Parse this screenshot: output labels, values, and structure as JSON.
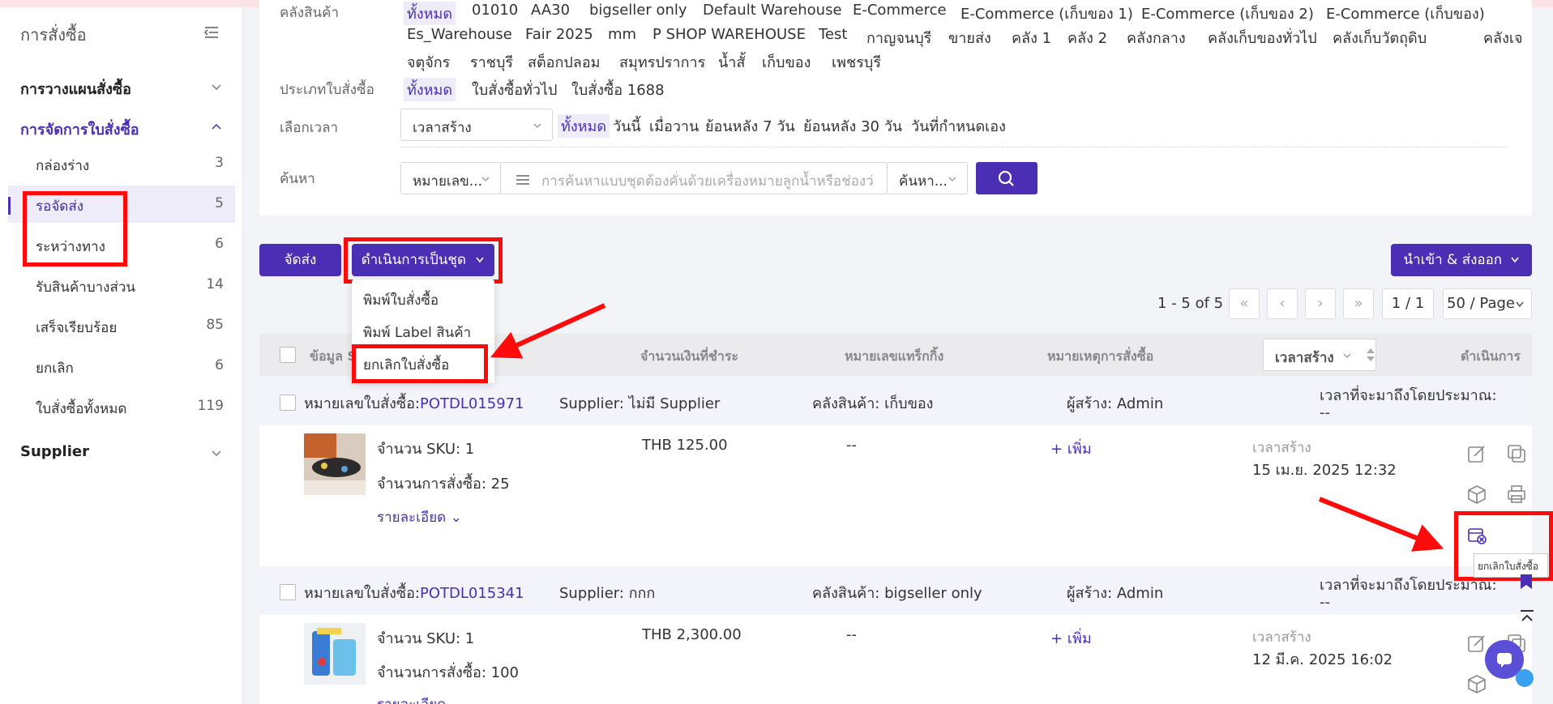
{
  "sidebar": {
    "title": "การสั่งซื้อ",
    "groups": [
      {
        "label": "การวางแผนสั่งซื้อ"
      },
      {
        "label": "การจัดการใบสั่งซื้อ"
      },
      {
        "label": "Supplier"
      }
    ],
    "items": [
      {
        "label": "กล่องร่าง",
        "count": "3"
      },
      {
        "label": "รอจัดส่ง",
        "count": "5"
      },
      {
        "label": "ระหว่างทาง",
        "count": "6"
      },
      {
        "label": "รับสินค้าบางส่วน",
        "count": "14"
      },
      {
        "label": "เสร็จเรียบร้อย",
        "count": "85"
      },
      {
        "label": "ยกเลิก",
        "count": "6"
      },
      {
        "label": "ใบสั่งซื้อทั้งหมด",
        "count": "119"
      }
    ]
  },
  "filters": {
    "warehouse_label": "คลังสินค้า",
    "warehouse_row1": [
      "ทั้งหมด",
      "01010",
      "AA30",
      "bigseller only",
      "Default Warehouse",
      "E-Commerce",
      "E-Commerce (เก็บของ 1)",
      "E-Commerce (เก็บของ 2)",
      "E-Commerce (เก็บของ)"
    ],
    "warehouse_row2": [
      "Es_Warehouse",
      "Fair 2025",
      "mm",
      "P SHOP WAREHOUSE",
      "Test",
      "กาญจนบุรี",
      "ขายส่ง",
      "คลัง 1",
      "คลัง 2",
      "คลังกลาง",
      "คลังเก็บของทั่วไป",
      "คลังเก็บวัตถุดิบ",
      "คลังเจ"
    ],
    "warehouse_row3": [
      "จตุจักร",
      "ราชบุรี",
      "สต็อกปลอม",
      "สมุทรปราการ",
      "น้ำสั้",
      "เก็บของ",
      "เพชรบุรี"
    ],
    "type_label": "ประเภทใบสั่งซื้อ",
    "type_options": [
      "ทั้งหมด",
      "ใบสั่งซื้อทั่วไป",
      "ใบสั่งซื้อ 1688"
    ],
    "time_label": "เลือกเวลา",
    "time_select": "เวลาสร้าง",
    "time_options": [
      "ทั้งหมด",
      "วันนี้",
      "เมื่อวาน",
      "ย้อนหลัง 7 วัน",
      "ย้อนหลัง 30 วัน",
      "วันที่กำหนดเอง"
    ],
    "search_label": "ค้นหา",
    "search_field": "หมายเลข...",
    "search_placeholder": "การค้นหาแบบชุดต้องคั่นด้วยเครื่องหมายลูกน้ำหรือช่องว่าง",
    "search_mode": "ค้นหา..."
  },
  "toolbar": {
    "ship_label": "จัดส่ง",
    "batch_label": "ดำเนินการเป็นชุด",
    "import_export_label": "นำเข้า & ส่งออก",
    "batch_menu": [
      "พิมพ์ใบสั่งซื้อ",
      "พิมพ์ Label สินค้า",
      "ยกเลิกใบสั่งซื้อ"
    ]
  },
  "pager": {
    "range": "1 - 5 of 5",
    "page": "1 / 1",
    "page_size": "50 / Page"
  },
  "table": {
    "headers": {
      "info": "ข้อมูล S",
      "amount": "จำนวนเงินที่ชำระ",
      "tracking": "หมายเลขแทร็กกิ้ง",
      "note": "หมายเหตุการสั่งซื้อ",
      "sort": "เวลาสร้าง",
      "actions": "ดำเนินการ"
    },
    "orders": [
      {
        "order_label": "หมายเลขใบสั่งซื้อ:",
        "order_no": "POTDL015971",
        "supplier": "Supplier: ไม่มี Supplier",
        "warehouse": "คลังสินค้า: เก็บของ",
        "creator": "ผู้สร้าง: Admin",
        "eta_label": "เวลาที่จะมาถึงโดยประมาณ:",
        "eta": "--",
        "sku": "จำนวน SKU: 1",
        "qty": "จำนวนการสั่งซื้อ: 25",
        "details": "รายละเอียด",
        "amount": "THB 125.00",
        "tracking": "--",
        "note_add": "+ เพิ่ม",
        "created_label": "เวลาสร้าง",
        "created": "15 เม.ย. 2025 12:32"
      },
      {
        "order_label": "หมายเลขใบสั่งซื้อ:",
        "order_no": "POTDL015341",
        "supplier": "Supplier: กกก",
        "warehouse": "คลังสินค้า: bigseller only",
        "creator": "ผู้สร้าง: Admin",
        "eta_label": "เวลาที่จะมาถึงโดยประมาณ:",
        "eta": "--",
        "sku": "จำนวน SKU: 1",
        "qty": "จำนวนการสั่งซื้อ: 100",
        "details": "รายละเอียด",
        "amount": "THB 2,300.00",
        "tracking": "--",
        "note_add": "+ เพิ่ม",
        "created_label": "เวลาสร้าง",
        "created": "12 มี.ค. 2025 16:02"
      }
    ]
  },
  "tooltip": "ยกเลิกใบสั่งซื้อ",
  "colors": {
    "accent": "#4a2fb5",
    "highlight": "#ff0b0b"
  }
}
